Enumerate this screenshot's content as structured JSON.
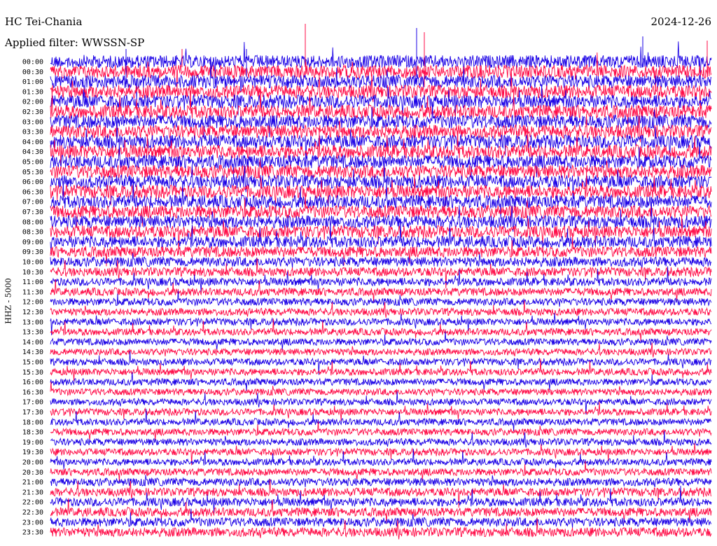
{
  "header": {
    "station": "HC Tei-Chania",
    "filter": "Applied filter: WWSSN-SP",
    "date": "2024-12-26"
  },
  "chart_data": {
    "type": "line",
    "title": "HC Tei-Chania",
    "subtitle": "Applied filter: WWSSN-SP",
    "date": "2024-12-26",
    "ylabel": "HHZ - 5000",
    "xlabel": "",
    "row_labels": [
      "00:00",
      "00:30",
      "01:00",
      "01:30",
      "02:00",
      "02:30",
      "03:00",
      "03:30",
      "04:00",
      "04:30",
      "05:00",
      "05:30",
      "06:00",
      "06:30",
      "07:00",
      "07:30",
      "08:00",
      "08:30",
      "09:00",
      "09:30",
      "10:00",
      "10:30",
      "11:00",
      "11:30",
      "12:00",
      "12:30",
      "13:00",
      "13:30",
      "14:00",
      "14:30",
      "15:00",
      "15:30",
      "16:00",
      "16:30",
      "17:00",
      "17:30",
      "18:00",
      "18:30",
      "19:00",
      "19:30",
      "20:00",
      "20:30",
      "21:00",
      "21:30",
      "22:00",
      "22:30",
      "23:00",
      "23:30"
    ],
    "row_minutes": 30,
    "series_colors": [
      "#1a00e6",
      "#ff0a46"
    ],
    "relative_noise_level": [
      0.92,
      0.95,
      0.95,
      0.96,
      0.97,
      0.97,
      0.98,
      0.98,
      0.98,
      0.98,
      0.97,
      0.97,
      0.96,
      0.95,
      0.94,
      0.92,
      0.9,
      0.86,
      0.8,
      0.72,
      0.62,
      0.55,
      0.48,
      0.45,
      0.42,
      0.4,
      0.38,
      0.37,
      0.36,
      0.35,
      0.36,
      0.37,
      0.36,
      0.35,
      0.34,
      0.36,
      0.36,
      0.37,
      0.38,
      0.37,
      0.36,
      0.4,
      0.46,
      0.5,
      0.52,
      0.54,
      0.55,
      0.58
    ],
    "grid": false,
    "legend": "none"
  }
}
